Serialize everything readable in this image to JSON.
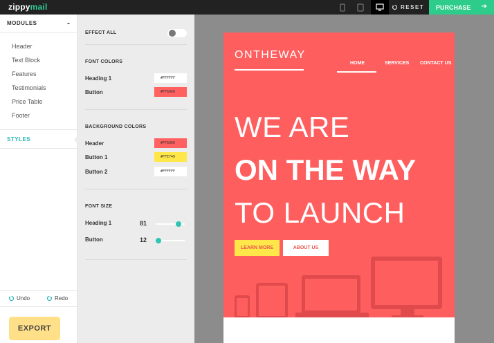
{
  "app": {
    "logo_part1": "zippy",
    "logo_part2": "mail"
  },
  "topbar": {
    "reset_label": "RESET",
    "purchase_label": "PURCHASE"
  },
  "modules": {
    "title": "MODULES",
    "collapse_symbol": "-",
    "items": [
      "Header",
      "Text Block",
      "Features",
      "Testimonials",
      "Price Table",
      "Footer"
    ]
  },
  "styles_label": "STYLES",
  "history": {
    "undo": "Undo",
    "redo": "Redo"
  },
  "export_label": "EXPORT",
  "panel": {
    "effect_all": "EFFECT ALL",
    "font_colors": {
      "title": "FONT COLORS",
      "rows": [
        {
          "label": "Heading 1",
          "value": "#FFFFFF",
          "color": "#FFFFFF"
        },
        {
          "label": "Button",
          "value": "#FF6060",
          "color": "#FF6060"
        }
      ]
    },
    "background_colors": {
      "title": "BACKGROUND COLORS",
      "rows": [
        {
          "label": "Header",
          "value": "#FF6060",
          "color": "#FF6060"
        },
        {
          "label": "Button 1",
          "value": "#FFE749",
          "color": "#FFE749"
        },
        {
          "label": "Button 2",
          "value": "#FFFFFF",
          "color": "#FFFFFF"
        }
      ]
    },
    "font_size": {
      "title": "FONT SIZE",
      "rows": [
        {
          "label": "Heading 1",
          "value": "81"
        },
        {
          "label": "Button",
          "value": "12"
        }
      ]
    }
  },
  "preview": {
    "brand": "ONTHEWAY",
    "nav": [
      "HOME",
      "SERVICES",
      "CONTACT US"
    ],
    "hero_line1": "WE ARE",
    "hero_line2": "ON THE WAY",
    "hero_line3": "TO LAUNCH",
    "btn_primary": "LEARN MORE",
    "btn_secondary": "ABOUT US"
  },
  "colors": {
    "accent": "#2ecc8a",
    "teal": "#2bb5b5",
    "coral": "#ff5e5f",
    "yellow": "#ffe749",
    "export": "#ffe088"
  }
}
